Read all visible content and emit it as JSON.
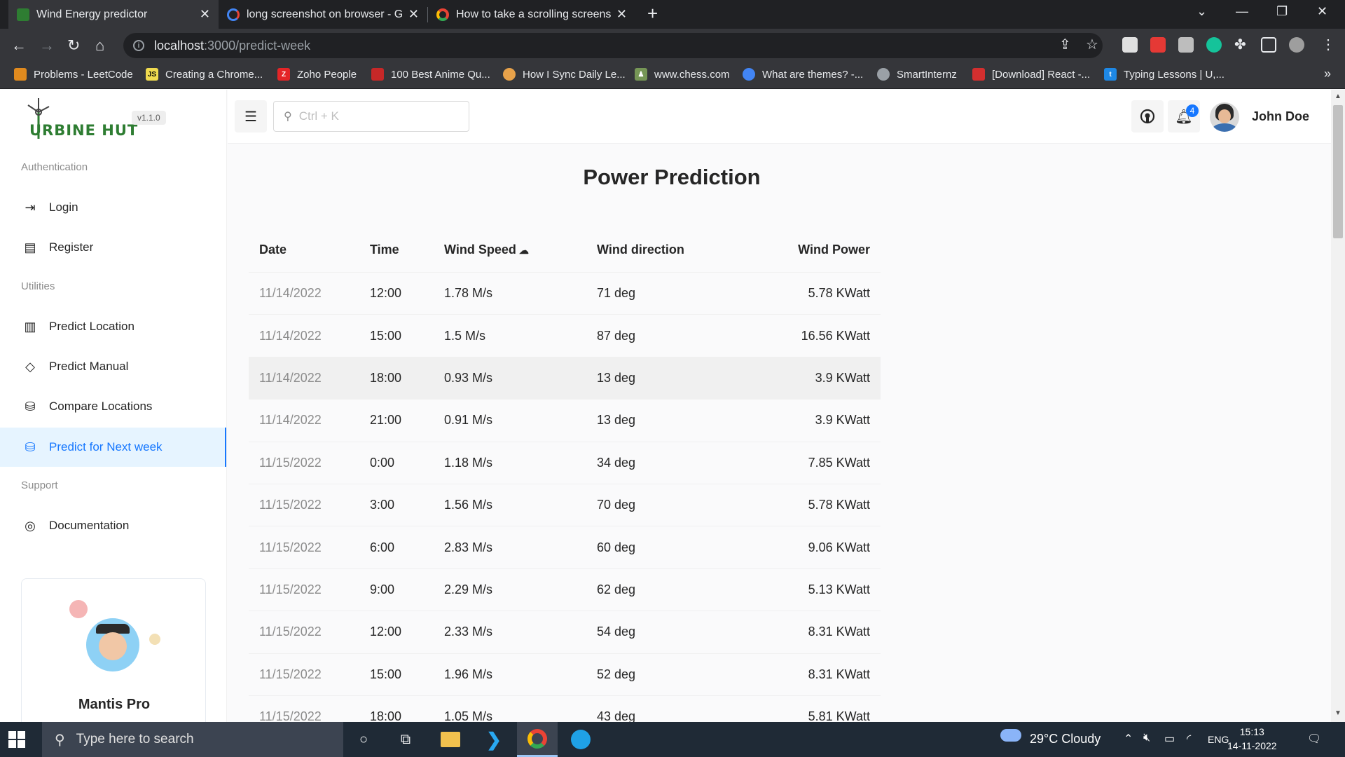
{
  "browser": {
    "tabs": [
      {
        "title": "Wind Energy predictor",
        "active": true
      },
      {
        "title": "long screenshot on browser - Go",
        "active": false
      },
      {
        "title": "How to take a scrolling screensh",
        "active": false
      }
    ],
    "url_host": "localhost",
    "url_path": ":3000/predict-week",
    "bookmarks": [
      {
        "label": "Problems - LeetCode",
        "icon": "leetcode-icon",
        "color": "#e08a1e"
      },
      {
        "label": "Creating a Chrome...",
        "icon": "js-icon",
        "color": "#f0db4f"
      },
      {
        "label": "Zoho People",
        "icon": "zoho-icon",
        "color": "#e42527"
      },
      {
        "label": "100 Best Anime Qu...",
        "icon": "anime-icon",
        "color": "#c62828"
      },
      {
        "label": "How I Sync Daily Le...",
        "icon": "sync-icon",
        "color": "#e8a24a"
      },
      {
        "label": "www.chess.com",
        "icon": "chess-icon",
        "color": "#769656"
      },
      {
        "label": "What are themes? -...",
        "icon": "chrome-icon",
        "color": "#4285f4"
      },
      {
        "label": "SmartInternz",
        "icon": "globe-icon",
        "color": "#9aa0a6"
      },
      {
        "label": "[Download] React -...",
        "icon": "react-download-icon",
        "color": "#d32f2f"
      },
      {
        "label": "Typing Lessons | U,...",
        "icon": "typing-icon",
        "color": "#1e88e5"
      }
    ]
  },
  "sidebar": {
    "brand": "URBINE HUT",
    "version": "v1.1.0",
    "groups": {
      "authentication": "Authentication",
      "utilities": "Utilities",
      "support": "Support"
    },
    "items": {
      "login": "Login",
      "register": "Register",
      "predict_location": "Predict Location",
      "predict_manual": "Predict Manual",
      "compare_locations": "Compare Locations",
      "predict_next_week": "Predict for Next week",
      "documentation": "Documentation"
    },
    "promo_title": "Mantis Pro"
  },
  "header": {
    "search_placeholder": "Ctrl + K",
    "notification_count": "4",
    "user_name": "John Doe"
  },
  "main": {
    "title": "Power Prediction",
    "columns": [
      "Date",
      "Time",
      "Wind Speed",
      "Wind direction",
      "Wind Power"
    ],
    "rows": [
      [
        "11/14/2022",
        "12:00",
        "1.78 M/s",
        "71 deg",
        "5.78 KWatt"
      ],
      [
        "11/14/2022",
        "15:00",
        "1.5 M/s",
        "87 deg",
        "16.56 KWatt"
      ],
      [
        "11/14/2022",
        "18:00",
        "0.93 M/s",
        "13 deg",
        "3.9 KWatt"
      ],
      [
        "11/14/2022",
        "21:00",
        "0.91 M/s",
        "13 deg",
        "3.9 KWatt"
      ],
      [
        "11/15/2022",
        "0:00",
        "1.18 M/s",
        "34 deg",
        "7.85 KWatt"
      ],
      [
        "11/15/2022",
        "3:00",
        "1.56 M/s",
        "70 deg",
        "5.78 KWatt"
      ],
      [
        "11/15/2022",
        "6:00",
        "2.83 M/s",
        "60 deg",
        "9.06 KWatt"
      ],
      [
        "11/15/2022",
        "9:00",
        "2.29 M/s",
        "62 deg",
        "5.13 KWatt"
      ],
      [
        "11/15/2022",
        "12:00",
        "2.33 M/s",
        "54 deg",
        "8.31 KWatt"
      ],
      [
        "11/15/2022",
        "15:00",
        "1.96 M/s",
        "52 deg",
        "8.31 KWatt"
      ],
      [
        "11/15/2022",
        "18:00",
        "1.05 M/s",
        "43 deg",
        "5.81 KWatt"
      ]
    ]
  },
  "taskbar": {
    "search_placeholder": "Type here to search",
    "weather": "29°C  Cloudy",
    "language": "ENG",
    "time": "15:13",
    "date": "14-11-2022"
  }
}
